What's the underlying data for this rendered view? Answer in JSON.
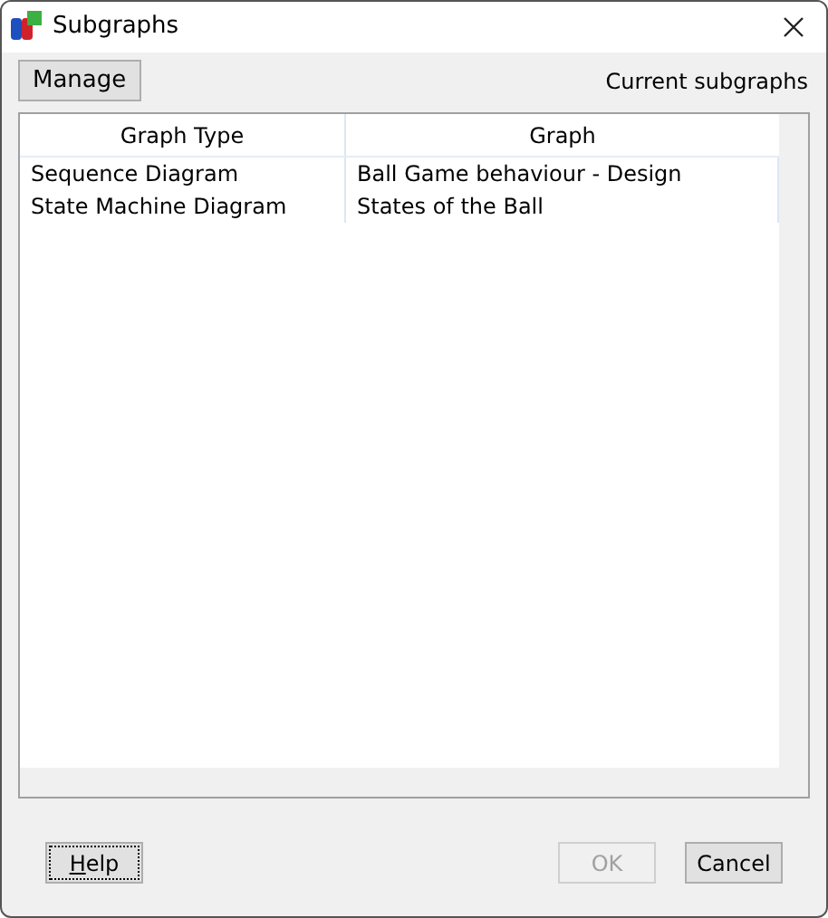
{
  "window": {
    "title": "Subgraphs"
  },
  "manage_button": {
    "label": "Manage"
  },
  "list_title": "Current subgraphs",
  "table": {
    "columns": [
      "Graph Type",
      "Graph"
    ],
    "rows": [
      [
        "Sequence Diagram",
        "Ball Game behaviour - Design"
      ],
      [
        "State Machine Diagram",
        "States of the Ball"
      ]
    ]
  },
  "buttons": [
    {
      "label": "Help",
      "focused": true,
      "disabled": false
    },
    {
      "label": "OK",
      "focused": false,
      "disabled": true
    },
    {
      "label": "Cancel",
      "focused": false,
      "disabled": false
    }
  ]
}
